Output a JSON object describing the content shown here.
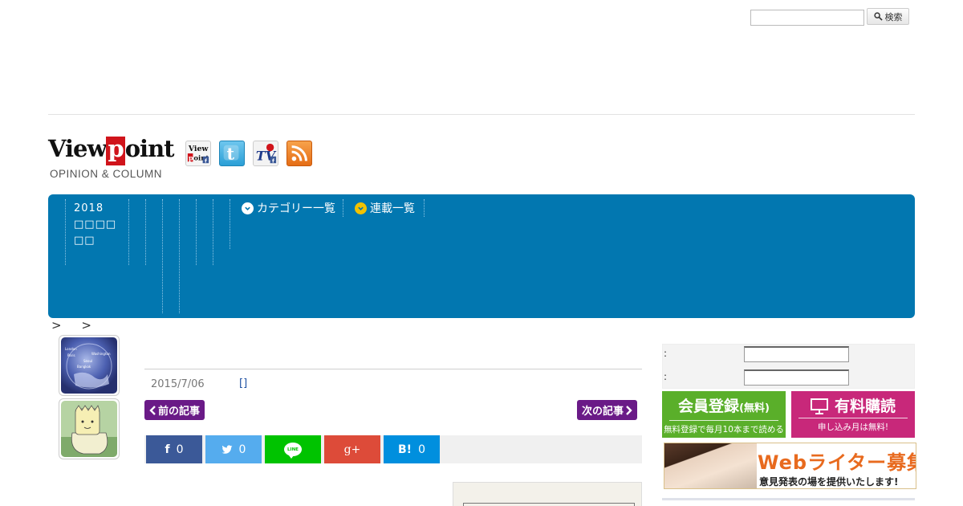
{
  "search": {
    "placeholder": "",
    "button_label": "検索"
  },
  "logo": {
    "pre": "View",
    "p": "p",
    "post": "oint",
    "subtitle": "OPINION & COLUMN"
  },
  "social_icons": [
    "viewpoint-facebook-icon",
    "twitter-icon",
    "viewpoint-tv-facebook-icon",
    "rss-icon"
  ],
  "nav": {
    "year_label": "2018 □□□□ □□",
    "items": [
      {
        "label": "カテゴリー一覧",
        "icon": "chevron-down-circle-icon",
        "icon_color": "#ffffff"
      },
      {
        "label": "連載一覧",
        "icon": "chevron-down-circle-icon",
        "icon_color": "#f2c200"
      }
    ]
  },
  "breadcrumb": "> >",
  "article": {
    "date": "2015/7/06",
    "category": "[]",
    "prev_label": "前の記事",
    "next_label": "次の記事"
  },
  "share": {
    "facebook": {
      "icon": "f",
      "count": "0"
    },
    "twitter": {
      "icon": "twitter-bird",
      "count": "0"
    },
    "line": {
      "icon": "LINE"
    },
    "googleplus": {
      "icon": "g+"
    },
    "hatena": {
      "icon": "B!",
      "count": "0"
    }
  },
  "login": {
    "user_label": ":",
    "pass_label": ":"
  },
  "banners": {
    "member": {
      "title": "会員登録",
      "title_suffix": "(無料)",
      "sub": "無料登録で毎月10本まで読める"
    },
    "paid": {
      "title": "有料購読",
      "sub": "申し込み月は無料!"
    },
    "writer": {
      "title": "Webライター募集",
      "sub": "意見発表の場を提供いたします!"
    }
  },
  "colors": {
    "nav_bg": "#0277b0",
    "pager_bg": "#6a1a87",
    "facebook": "#3b5998",
    "twitter": "#55acee",
    "line": "#00c300",
    "googleplus": "#dd4b39",
    "hatena": "#008fde",
    "member_banner": "#5aaf2a",
    "paid_banner": "#c8287a",
    "writer_title": "#e86a1e"
  }
}
